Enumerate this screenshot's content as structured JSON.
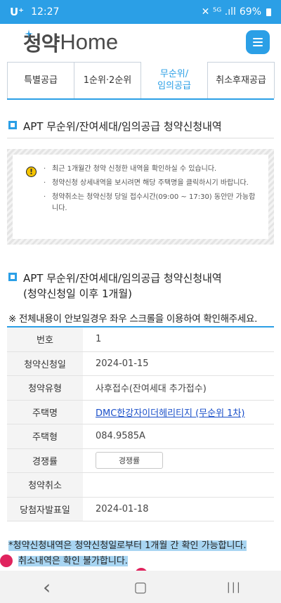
{
  "status_bar": {
    "carrier": "U⁺",
    "time": "12:27",
    "icons": "✕ ⁵ᴳ .ıll",
    "battery": "69%"
  },
  "header": {
    "logo_korean": "청약",
    "logo_english": "Home",
    "menu_icon": "hamburger-menu-icon"
  },
  "tabs": [
    {
      "label": "특별공급",
      "active": false
    },
    {
      "label": "1순위·2순위",
      "active": false
    },
    {
      "label": "무순위/\n임의공급",
      "active": true
    },
    {
      "label": "취소후재공급",
      "active": false
    }
  ],
  "section1": {
    "title": "APT 무순위/잔여세대/임의공급 청약신청내역"
  },
  "notice": {
    "icon": "warning-icon",
    "lines": [
      "최근 1개월간 청약 신청한 내역을 확인하실 수 있습니다.",
      "청약신청 상세내역을 보시려면 해당 주택명을 클릭하시기 바랍니다.",
      "청약취소는 청약신청 당일 접수시간(09:00 ~ 17:30) 동안만 가능합니다."
    ]
  },
  "section2": {
    "title": "APT 무순위/잔여세대/임의공급 청약신청내역",
    "subtitle": "(청약신청일 이후 1개월)"
  },
  "scroll_note": "※ 전체내용이 안보일경우 좌우 스크롤을 이용하여 확인해주세요.",
  "table": {
    "rows": [
      {
        "label": "번호",
        "value": "1"
      },
      {
        "label": "청약신청일",
        "value": "2024-01-15"
      },
      {
        "label": "청약유형",
        "value": "사후접수(잔여세대 추가접수)"
      },
      {
        "label": "주택명",
        "value": "DMC한강자이더헤리티지 (무순위 1차)"
      },
      {
        "label": "주택형",
        "value": "084.9585A"
      },
      {
        "label": "경쟁률",
        "value": "경쟁률"
      },
      {
        "label": "청약취소",
        "value": ""
      },
      {
        "label": "당첨자발표일",
        "value": "2024-01-18"
      }
    ]
  },
  "bottom_note": {
    "line1": "*청약신청내역은 청약신청일로부터 1개월 간 확인 가능합니다.",
    "line2": "취소내역은 확인 불가합니다."
  },
  "navbar": {
    "back": "‹",
    "home": "▢",
    "recents": "|||"
  },
  "colors": {
    "accent": "#2b9fe6",
    "link": "#1a4fc9",
    "highlight": "#a8d5f2"
  }
}
